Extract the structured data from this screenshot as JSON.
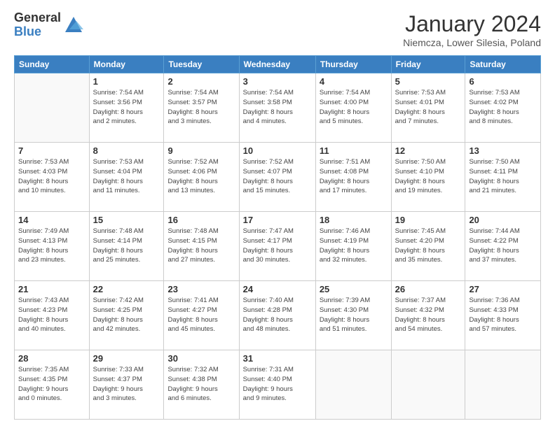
{
  "logo": {
    "general": "General",
    "blue": "Blue"
  },
  "title": "January 2024",
  "subtitle": "Niemcza, Lower Silesia, Poland",
  "days_of_week": [
    "Sunday",
    "Monday",
    "Tuesday",
    "Wednesday",
    "Thursday",
    "Friday",
    "Saturday"
  ],
  "weeks": [
    [
      {
        "day": "",
        "info": ""
      },
      {
        "day": "1",
        "info": "Sunrise: 7:54 AM\nSunset: 3:56 PM\nDaylight: 8 hours\nand 2 minutes."
      },
      {
        "day": "2",
        "info": "Sunrise: 7:54 AM\nSunset: 3:57 PM\nDaylight: 8 hours\nand 3 minutes."
      },
      {
        "day": "3",
        "info": "Sunrise: 7:54 AM\nSunset: 3:58 PM\nDaylight: 8 hours\nand 4 minutes."
      },
      {
        "day": "4",
        "info": "Sunrise: 7:54 AM\nSunset: 4:00 PM\nDaylight: 8 hours\nand 5 minutes."
      },
      {
        "day": "5",
        "info": "Sunrise: 7:53 AM\nSunset: 4:01 PM\nDaylight: 8 hours\nand 7 minutes."
      },
      {
        "day": "6",
        "info": "Sunrise: 7:53 AM\nSunset: 4:02 PM\nDaylight: 8 hours\nand 8 minutes."
      }
    ],
    [
      {
        "day": "7",
        "info": "Sunrise: 7:53 AM\nSunset: 4:03 PM\nDaylight: 8 hours\nand 10 minutes."
      },
      {
        "day": "8",
        "info": "Sunrise: 7:53 AM\nSunset: 4:04 PM\nDaylight: 8 hours\nand 11 minutes."
      },
      {
        "day": "9",
        "info": "Sunrise: 7:52 AM\nSunset: 4:06 PM\nDaylight: 8 hours\nand 13 minutes."
      },
      {
        "day": "10",
        "info": "Sunrise: 7:52 AM\nSunset: 4:07 PM\nDaylight: 8 hours\nand 15 minutes."
      },
      {
        "day": "11",
        "info": "Sunrise: 7:51 AM\nSunset: 4:08 PM\nDaylight: 8 hours\nand 17 minutes."
      },
      {
        "day": "12",
        "info": "Sunrise: 7:50 AM\nSunset: 4:10 PM\nDaylight: 8 hours\nand 19 minutes."
      },
      {
        "day": "13",
        "info": "Sunrise: 7:50 AM\nSunset: 4:11 PM\nDaylight: 8 hours\nand 21 minutes."
      }
    ],
    [
      {
        "day": "14",
        "info": "Sunrise: 7:49 AM\nSunset: 4:13 PM\nDaylight: 8 hours\nand 23 minutes."
      },
      {
        "day": "15",
        "info": "Sunrise: 7:48 AM\nSunset: 4:14 PM\nDaylight: 8 hours\nand 25 minutes."
      },
      {
        "day": "16",
        "info": "Sunrise: 7:48 AM\nSunset: 4:15 PM\nDaylight: 8 hours\nand 27 minutes."
      },
      {
        "day": "17",
        "info": "Sunrise: 7:47 AM\nSunset: 4:17 PM\nDaylight: 8 hours\nand 30 minutes."
      },
      {
        "day": "18",
        "info": "Sunrise: 7:46 AM\nSunset: 4:19 PM\nDaylight: 8 hours\nand 32 minutes."
      },
      {
        "day": "19",
        "info": "Sunrise: 7:45 AM\nSunset: 4:20 PM\nDaylight: 8 hours\nand 35 minutes."
      },
      {
        "day": "20",
        "info": "Sunrise: 7:44 AM\nSunset: 4:22 PM\nDaylight: 8 hours\nand 37 minutes."
      }
    ],
    [
      {
        "day": "21",
        "info": "Sunrise: 7:43 AM\nSunset: 4:23 PM\nDaylight: 8 hours\nand 40 minutes."
      },
      {
        "day": "22",
        "info": "Sunrise: 7:42 AM\nSunset: 4:25 PM\nDaylight: 8 hours\nand 42 minutes."
      },
      {
        "day": "23",
        "info": "Sunrise: 7:41 AM\nSunset: 4:27 PM\nDaylight: 8 hours\nand 45 minutes."
      },
      {
        "day": "24",
        "info": "Sunrise: 7:40 AM\nSunset: 4:28 PM\nDaylight: 8 hours\nand 48 minutes."
      },
      {
        "day": "25",
        "info": "Sunrise: 7:39 AM\nSunset: 4:30 PM\nDaylight: 8 hours\nand 51 minutes."
      },
      {
        "day": "26",
        "info": "Sunrise: 7:37 AM\nSunset: 4:32 PM\nDaylight: 8 hours\nand 54 minutes."
      },
      {
        "day": "27",
        "info": "Sunrise: 7:36 AM\nSunset: 4:33 PM\nDaylight: 8 hours\nand 57 minutes."
      }
    ],
    [
      {
        "day": "28",
        "info": "Sunrise: 7:35 AM\nSunset: 4:35 PM\nDaylight: 9 hours\nand 0 minutes."
      },
      {
        "day": "29",
        "info": "Sunrise: 7:33 AM\nSunset: 4:37 PM\nDaylight: 9 hours\nand 3 minutes."
      },
      {
        "day": "30",
        "info": "Sunrise: 7:32 AM\nSunset: 4:38 PM\nDaylight: 9 hours\nand 6 minutes."
      },
      {
        "day": "31",
        "info": "Sunrise: 7:31 AM\nSunset: 4:40 PM\nDaylight: 9 hours\nand 9 minutes."
      },
      {
        "day": "",
        "info": ""
      },
      {
        "day": "",
        "info": ""
      },
      {
        "day": "",
        "info": ""
      }
    ]
  ]
}
